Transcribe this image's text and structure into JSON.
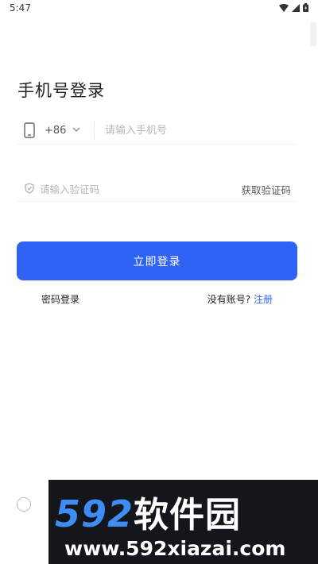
{
  "status_bar": {
    "time": "5:47",
    "icons": [
      "wifi-icon",
      "signal-icon",
      "battery-icon"
    ]
  },
  "page": {
    "title": "手机号登录"
  },
  "phone_field": {
    "icon": "phone-icon",
    "country_code": "+86",
    "placeholder": "请输入手机号",
    "value": ""
  },
  "code_field": {
    "icon": "shield-icon",
    "placeholder": "请输入验证码",
    "value": "",
    "get_code_label": "获取验证码"
  },
  "login_button": {
    "label": "立即登录",
    "color": "#2f63f5"
  },
  "footer_links": {
    "password_login": "密码登录",
    "no_account": "没有账号?",
    "register": "注册"
  },
  "agreement": {
    "checked": false
  },
  "watermark": {
    "brand_number": "592",
    "brand_text": "软件园",
    "url": "www.592xiazai.com"
  }
}
